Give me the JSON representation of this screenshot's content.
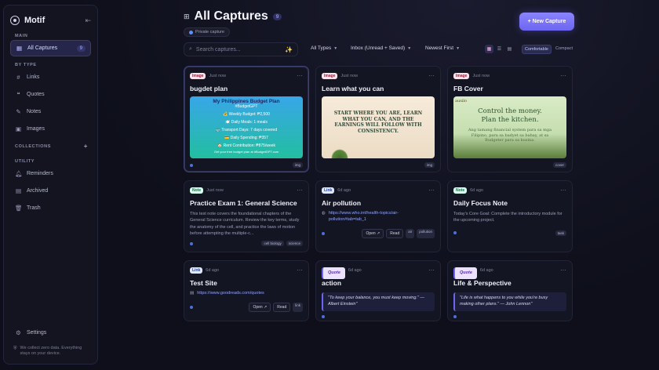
{
  "app": {
    "name": "Motif"
  },
  "sidebar": {
    "main_label": "MAIN",
    "all_captures": {
      "label": "All Captures",
      "count": "9"
    },
    "by_type_label": "BY TYPE",
    "types": [
      {
        "label": "Links",
        "icon": "hash-icon"
      },
      {
        "label": "Quotes",
        "icon": "quote-icon"
      },
      {
        "label": "Notes",
        "icon": "pen-icon"
      },
      {
        "label": "Images",
        "icon": "image-icon"
      }
    ],
    "collections_label": "COLLECTIONS",
    "utility_label": "UTILITY",
    "utility": [
      {
        "label": "Reminders",
        "icon": "bell-icon"
      },
      {
        "label": "Archived",
        "icon": "archive-icon"
      },
      {
        "label": "Trash",
        "icon": "trash-icon"
      }
    ],
    "settings_label": "Settings",
    "privacy_note": "We collect zero data. Everything stays on your device."
  },
  "header": {
    "title": "All Captures",
    "count": "9",
    "private_label": "Private capture",
    "new_button": "+ New Capture"
  },
  "toolbar": {
    "search_placeholder": "Search captures...",
    "type_filter": "All Types",
    "status_filter": "Inbox (Unread + Saved)",
    "sort": "Newest First",
    "density_comfortable": "Comfortable",
    "density_compact": "Compact"
  },
  "cards": [
    {
      "type": "Image",
      "time": "Just now",
      "title": "bugdet plan",
      "tag": "img",
      "thumb": {
        "title": "My Philippines Budget Plan",
        "sub": "#BudgetGPT",
        "lines": [
          "💰 Weekly Budget: ₱2,500",
          "🍽️ Daily Meals: 1 meals",
          "🚌 Transport Days: 7 days covered",
          "💳 Daily Spending: ₱357",
          "🏠 Rent Contribution: ₱875/week",
          "Get your free budget plan at #BudgetGPT.com"
        ]
      }
    },
    {
      "type": "Image",
      "time": "Just now",
      "title": "Learn what you can",
      "tag": "img",
      "thumb_text": "START WHERE YOU ARE, LEARN WHAT YOU CAN, AND THE EARNINGS WILL FOLLOW WITH CONSISTENCY."
    },
    {
      "type": "Image",
      "time": "Just now",
      "title": "FB Cover",
      "tag": "cover",
      "thumb": {
        "brand": "ausilo",
        "headline": "Control the money. Plan the kitchen.",
        "sub": "Ang tamang financial system para sa mga Filipino, para sa badyet sa bahay, at sa Budgeter para sa kusina."
      }
    },
    {
      "type": "Note",
      "time": "Just now",
      "title": "Practice Exam 1: General Science",
      "desc": "This test note covers the foundational chapters of the General Science curriculum. Review the key terms, study the anatomy of the cell, and practice the laws of motion before attempting the multiple-c...",
      "tags": [
        "cell biology",
        "science"
      ]
    },
    {
      "type": "Link",
      "time": "6d ago",
      "title": "Air pollution",
      "url": "https://www.who.int/health-topics/air-pollution#tab=tab_1",
      "open": "Open ↗",
      "read": "Read",
      "tags": [
        "air",
        "pollution"
      ]
    },
    {
      "type": "Note",
      "time": "6d ago",
      "title": "Daily Focus Note",
      "desc": "Today's Core Goal: Complete the introductory module for the upcoming project.",
      "tags": [
        "task"
      ]
    },
    {
      "type": "Link",
      "time": "6d ago",
      "title": "Test Site",
      "url": "https://www.goodreads.com/quotes",
      "open": "Open ↗",
      "read": "Read",
      "tags": [
        "link"
      ]
    },
    {
      "type": "Quote",
      "time": "6d ago",
      "title": "action",
      "quote": "\"To keep your balance, you must keep moving.\" — Albert Einstein\""
    },
    {
      "type": "Quote",
      "time": "6d ago",
      "title": "Life & Perspective",
      "quote": "\"Life is what happens to you while you're busy making other plans.\" — John Lennon\""
    }
  ],
  "colors": {
    "accent": "#6d66f0",
    "background": "#0e0f1a"
  }
}
